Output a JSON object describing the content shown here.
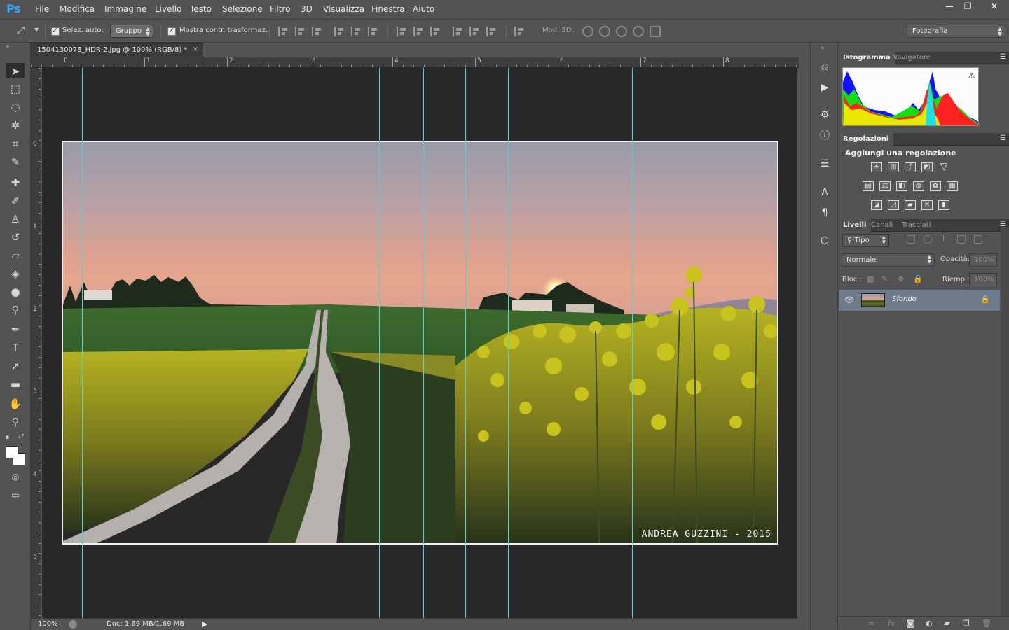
{
  "app": {
    "logo": "Ps"
  },
  "menu": [
    "File",
    "Modifica",
    "Immagine",
    "Livello",
    "Testo",
    "Selezione",
    "Filtro",
    "3D",
    "Visualizza",
    "Finestra",
    "Aiuto"
  ],
  "window_controls": {
    "minimize": "—",
    "restore": "❐",
    "close": "✕"
  },
  "options": {
    "auto_select_label": "Selez. auto:",
    "auto_select_value": "Gruppo",
    "show_transform_label": "Mostra contr. trasformaz.",
    "mode3d_label": "Mod. 3D:",
    "workspace": "Fotografia"
  },
  "document": {
    "tab_title": "1504130078_HDR-2.jpg @ 100% (RGB/8) *",
    "tab_close": "×",
    "watermark": "ANDREA GUZZINI - 2015"
  },
  "rulers": {
    "top": [
      "0",
      "1",
      "2",
      "3",
      "4",
      "5",
      "6",
      "7",
      "8"
    ],
    "left": [
      "0",
      "1",
      "2",
      "3",
      "4",
      "5"
    ]
  },
  "status": {
    "zoom": "100%",
    "doc_size": "Doc: 1,69 MB/1,69 MB",
    "arrow": "▶"
  },
  "panels": {
    "histogram_tabs": [
      "Istogramma",
      "Navigatore"
    ],
    "histogram_warning": "⚠",
    "adjustments_tab": "Regolazioni",
    "adjustments_title": "Aggiungi una regolazione",
    "layers_tabs": [
      "Livelli",
      "Canali",
      "Tracciati"
    ],
    "filter_kind": "Tipo",
    "blend_mode": "Normale",
    "opacity_label": "Opacità:",
    "opacity_value": "100%",
    "lock_label": "Bloc.:",
    "fill_label": "Riemp.:",
    "fill_value": "100%",
    "layer_name": "Sfondo"
  },
  "colors": {
    "guide": "#4cd5d5",
    "canvas_bg": "#282828",
    "ui_bg": "#535353",
    "selected_layer": "#6d7a8a",
    "ps_blue": "#31a8ff"
  }
}
